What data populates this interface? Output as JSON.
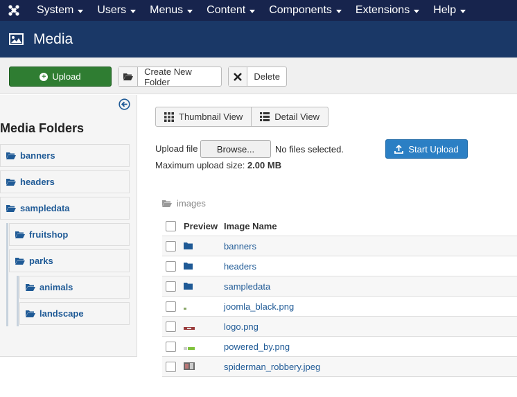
{
  "nav": {
    "menus": [
      "System",
      "Users",
      "Menus",
      "Content",
      "Components",
      "Extensions",
      "Help"
    ]
  },
  "header": {
    "title": "Media"
  },
  "toolbar": {
    "upload": "Upload",
    "new_folder": "Create New Folder",
    "delete": "Delete"
  },
  "sidebar": {
    "title": "Media Folders",
    "folders": [
      "banners",
      "headers",
      "sampledata",
      "fruitshop",
      "parks",
      "animals",
      "landscape"
    ]
  },
  "views": {
    "thumbnail": "Thumbnail View",
    "detail": "Detail View"
  },
  "upload": {
    "label": "Upload file",
    "browse": "Browse...",
    "no_file": "No files selected.",
    "start": "Start Upload",
    "max_label": "Maximum upload size:",
    "max_value": "2.00 MB"
  },
  "breadcrumb": "images",
  "table": {
    "headers": {
      "preview": "Preview",
      "name": "Image Name"
    },
    "rows": [
      {
        "name": "banners",
        "type": "folder"
      },
      {
        "name": "headers",
        "type": "folder"
      },
      {
        "name": "sampledata",
        "type": "folder"
      },
      {
        "name": "joomla_black.png",
        "type": "image"
      },
      {
        "name": "logo.png",
        "type": "image"
      },
      {
        "name": "powered_by.png",
        "type": "image"
      },
      {
        "name": "spiderman_robbery.jpeg",
        "type": "image"
      }
    ]
  },
  "colors": {
    "nav": "#17244d",
    "header": "#1a3867",
    "upload_green": "#2f7d32",
    "link": "#1f5a96",
    "start_upload": "#2b7fc4"
  }
}
